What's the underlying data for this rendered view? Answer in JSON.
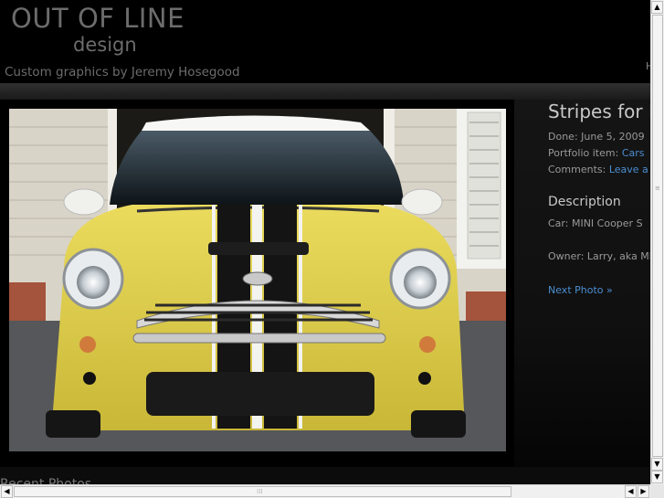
{
  "header": {
    "logo_main": "OUT OF LINE",
    "logo_sub": "design",
    "tagline": "Custom graphics by Jeremy Hosegood",
    "nav_partial": "H"
  },
  "photo": {
    "title": "Stripes for MINI",
    "done_label": "Done:",
    "done_value": "June 5, 2009",
    "portfolio_label": "Portfolio item:",
    "portfolio_link": "Cars",
    "comments_label": "Comments:",
    "comments_link": "Leave a comment",
    "description_heading": "Description",
    "car_line": "Car: MINI Cooper S",
    "owner_line": "Owner: Larry, aka MINI",
    "next_link": "Next Photo »"
  },
  "footer": {
    "recent_label": "Recent Photos"
  },
  "colors": {
    "link": "#4b8ed0",
    "car_yellow": "#e3d34e",
    "background": "#000000"
  }
}
